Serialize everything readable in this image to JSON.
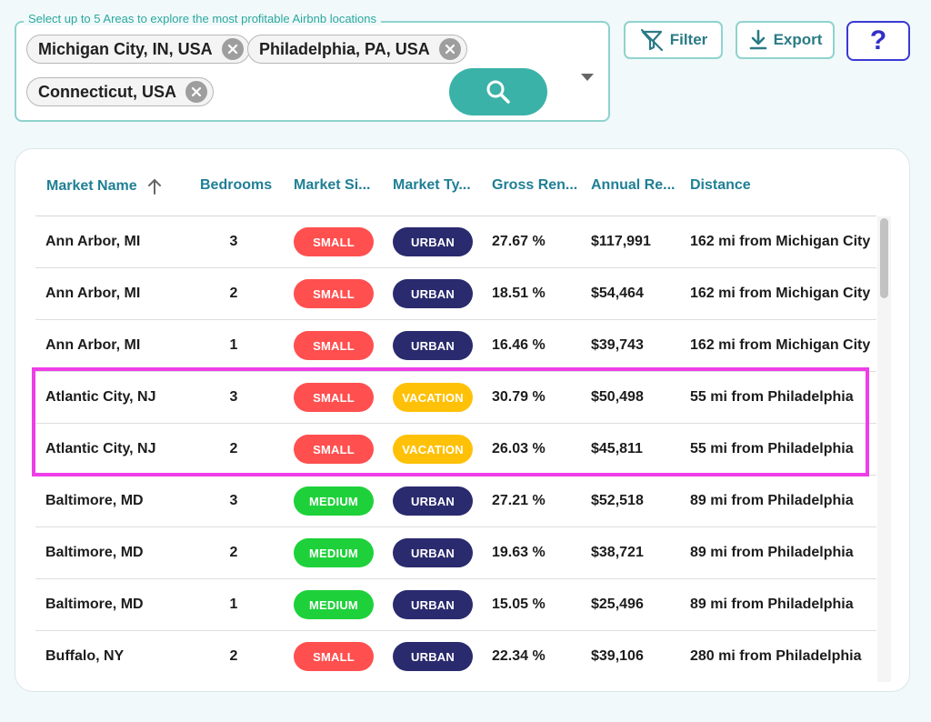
{
  "search": {
    "legend": "Select up to 5 Areas to explore the most profitable Airbnb locations",
    "chips": [
      "Michigan City, IN, USA",
      "Philadelphia, PA, USA",
      "Connecticut, USA"
    ],
    "search_icon": "search-icon",
    "dropdown_icon": "chevron-down-icon"
  },
  "toolbar": {
    "filter_label": "Filter",
    "filter_icon": "filter-off-icon",
    "export_label": "Export",
    "export_icon": "download-icon",
    "help_label": "?"
  },
  "table": {
    "headers": [
      "Market Name",
      "Bedrooms",
      "Market Si...",
      "Market Ty...",
      "Gross Ren...",
      "Annual Re...",
      "Distance"
    ],
    "sort_icon": "arrow-up-icon",
    "colors": {
      "SMALL": "#ff4f4f",
      "MEDIUM": "#1ed13a",
      "URBAN": "#2a2a6e",
      "VACATION": "#ffc107"
    },
    "rows": [
      {
        "market": "Ann Arbor, MI",
        "bedrooms": "3",
        "size": "SMALL",
        "type": "URBAN",
        "gross": "27.67 %",
        "annual": "$117,991",
        "distance": "162 mi from Michigan City"
      },
      {
        "market": "Ann Arbor, MI",
        "bedrooms": "2",
        "size": "SMALL",
        "type": "URBAN",
        "gross": "18.51 %",
        "annual": "$54,464",
        "distance": "162 mi from Michigan City"
      },
      {
        "market": "Ann Arbor, MI",
        "bedrooms": "1",
        "size": "SMALL",
        "type": "URBAN",
        "gross": "16.46 %",
        "annual": "$39,743",
        "distance": "162 mi from Michigan City"
      },
      {
        "market": "Atlantic City, NJ",
        "bedrooms": "3",
        "size": "SMALL",
        "type": "VACATION",
        "gross": "30.79 %",
        "annual": "$50,498",
        "distance": "55 mi from Philadelphia"
      },
      {
        "market": "Atlantic City, NJ",
        "bedrooms": "2",
        "size": "SMALL",
        "type": "VACATION",
        "gross": "26.03 %",
        "annual": "$45,811",
        "distance": "55 mi from Philadelphia"
      },
      {
        "market": "Baltimore, MD",
        "bedrooms": "3",
        "size": "MEDIUM",
        "type": "URBAN",
        "gross": "27.21 %",
        "annual": "$52,518",
        "distance": "89 mi from Philadelphia"
      },
      {
        "market": "Baltimore, MD",
        "bedrooms": "2",
        "size": "MEDIUM",
        "type": "URBAN",
        "gross": "19.63 %",
        "annual": "$38,721",
        "distance": "89 mi from Philadelphia"
      },
      {
        "market": "Baltimore, MD",
        "bedrooms": "1",
        "size": "MEDIUM",
        "type": "URBAN",
        "gross": "15.05 %",
        "annual": "$25,496",
        "distance": "89 mi from Philadelphia"
      },
      {
        "market": "Buffalo, NY",
        "bedrooms": "2",
        "size": "SMALL",
        "type": "URBAN",
        "gross": "22.34 %",
        "annual": "$39,106",
        "distance": "280 mi from Philadelphia"
      }
    ]
  }
}
